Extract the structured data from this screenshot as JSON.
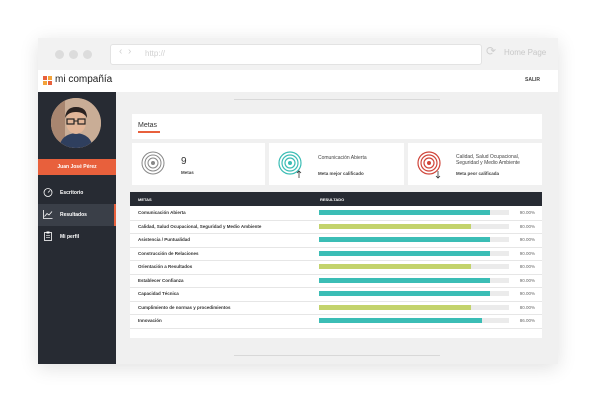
{
  "browser": {
    "url": "http://",
    "home_label": "Home Page",
    "back_icon": "chevron-left-icon",
    "forward_icon": "chevron-right-icon",
    "reload_icon": "reload-icon"
  },
  "app": {
    "brand": "mi compañía",
    "logout_label": "SALIR",
    "colors": {
      "accent": "#e8603c",
      "teal": "#3bbdb5",
      "lime": "#c3d36c",
      "dark": "#272b33"
    }
  },
  "sidebar": {
    "user_name": "Juan José Pérez",
    "items": [
      {
        "label": "Escritorio",
        "icon": "speedometer-icon"
      },
      {
        "label": "Resultados",
        "icon": "line-chart-icon"
      },
      {
        "label": "Mi perfil",
        "icon": "clipboard-icon"
      }
    ]
  },
  "page": {
    "title": "Metas"
  },
  "kpis": [
    {
      "value": "9",
      "label": "Metas",
      "icon": "target-icon"
    },
    {
      "name": "Comunicación Abierta",
      "label": "Meta mejor calificado",
      "icon": "target-up-icon"
    },
    {
      "name_line1": "Calidad, Salud Ocupacional,",
      "name_line2": "Seguridad y Medio Ambiente",
      "label": "Meta peor calificada",
      "icon": "target-down-icon"
    }
  ],
  "table": {
    "headers": [
      "METAS",
      "RESULTADO"
    ],
    "rows": [
      {
        "name": "Comunicación Abierta",
        "pct": "90.00%",
        "value": 0.9,
        "color": "#3bbdb5"
      },
      {
        "name": "Calidad, Salud Ocupacional, Seguridad y Medio Ambiente",
        "pct": "80.00%",
        "value": 0.8,
        "color": "#c3d36c"
      },
      {
        "name": "Asistencia / Puntualidad",
        "pct": "90.00%",
        "value": 0.9,
        "color": "#3bbdb5"
      },
      {
        "name": "Construcción de Relaciones",
        "pct": "90.00%",
        "value": 0.9,
        "color": "#3bbdb5"
      },
      {
        "name": "Orientación a Resultados",
        "pct": "80.00%",
        "value": 0.8,
        "color": "#c3d36c"
      },
      {
        "name": "Establecer Confianza",
        "pct": "90.00%",
        "value": 0.9,
        "color": "#3bbdb5"
      },
      {
        "name": "Capacidad Técnica",
        "pct": "90.00%",
        "value": 0.9,
        "color": "#3bbdb5"
      },
      {
        "name": "Cumplimiento de normas y procedimientos",
        "pct": "80.00%",
        "value": 0.8,
        "color": "#c3d36c"
      },
      {
        "name": "Innovación",
        "pct": "86.00%",
        "value": 0.86,
        "color": "#3bbdb5"
      }
    ]
  }
}
